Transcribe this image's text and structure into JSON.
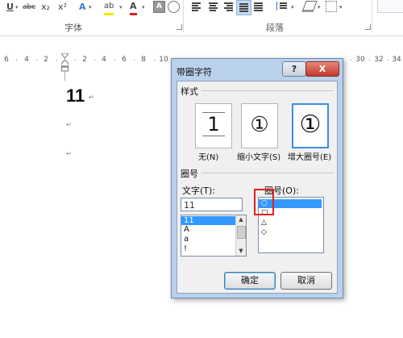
{
  "ribbon": {
    "font_group": {
      "label": "字体",
      "underline": "U",
      "strikethrough": "abc",
      "subscript": "x₂",
      "superscript": "x²",
      "text_effects": "A",
      "highlight": "ab",
      "font_color": "A",
      "char_shading": "A",
      "dropdown": "▾"
    },
    "paragraph_group": {
      "label": "段落"
    }
  },
  "ruler": {
    "ticks": [
      "6",
      "4",
      "2",
      "2",
      "4",
      "6",
      "8",
      "10",
      "30",
      "32",
      "34"
    ]
  },
  "document": {
    "text": "11",
    "paragraph_mark": "↵"
  },
  "dialog": {
    "title": "带圈字符",
    "help": "?",
    "close": "X",
    "style_section": "样式",
    "styles": [
      {
        "glyph": "1",
        "label": "无(N)"
      },
      {
        "glyph": "①",
        "label": "缩小文字(S)"
      },
      {
        "glyph": "①",
        "label": "增大圈号(E)"
      }
    ],
    "enclosure_section": "圈号",
    "text_label": "文字(T):",
    "text_value": "11",
    "text_options": [
      "11",
      "A",
      "a",
      "!"
    ],
    "enclosure_label": "圈号(O):",
    "enclosure_options": [
      "○",
      "□",
      "△",
      "◇"
    ],
    "ok": "确定",
    "cancel": "取消"
  },
  "colors": {
    "selection": "#3399ff",
    "dialog_frame": "#b9d1ea",
    "close_button": "#c2382a",
    "highlight_box": "#e02020"
  }
}
